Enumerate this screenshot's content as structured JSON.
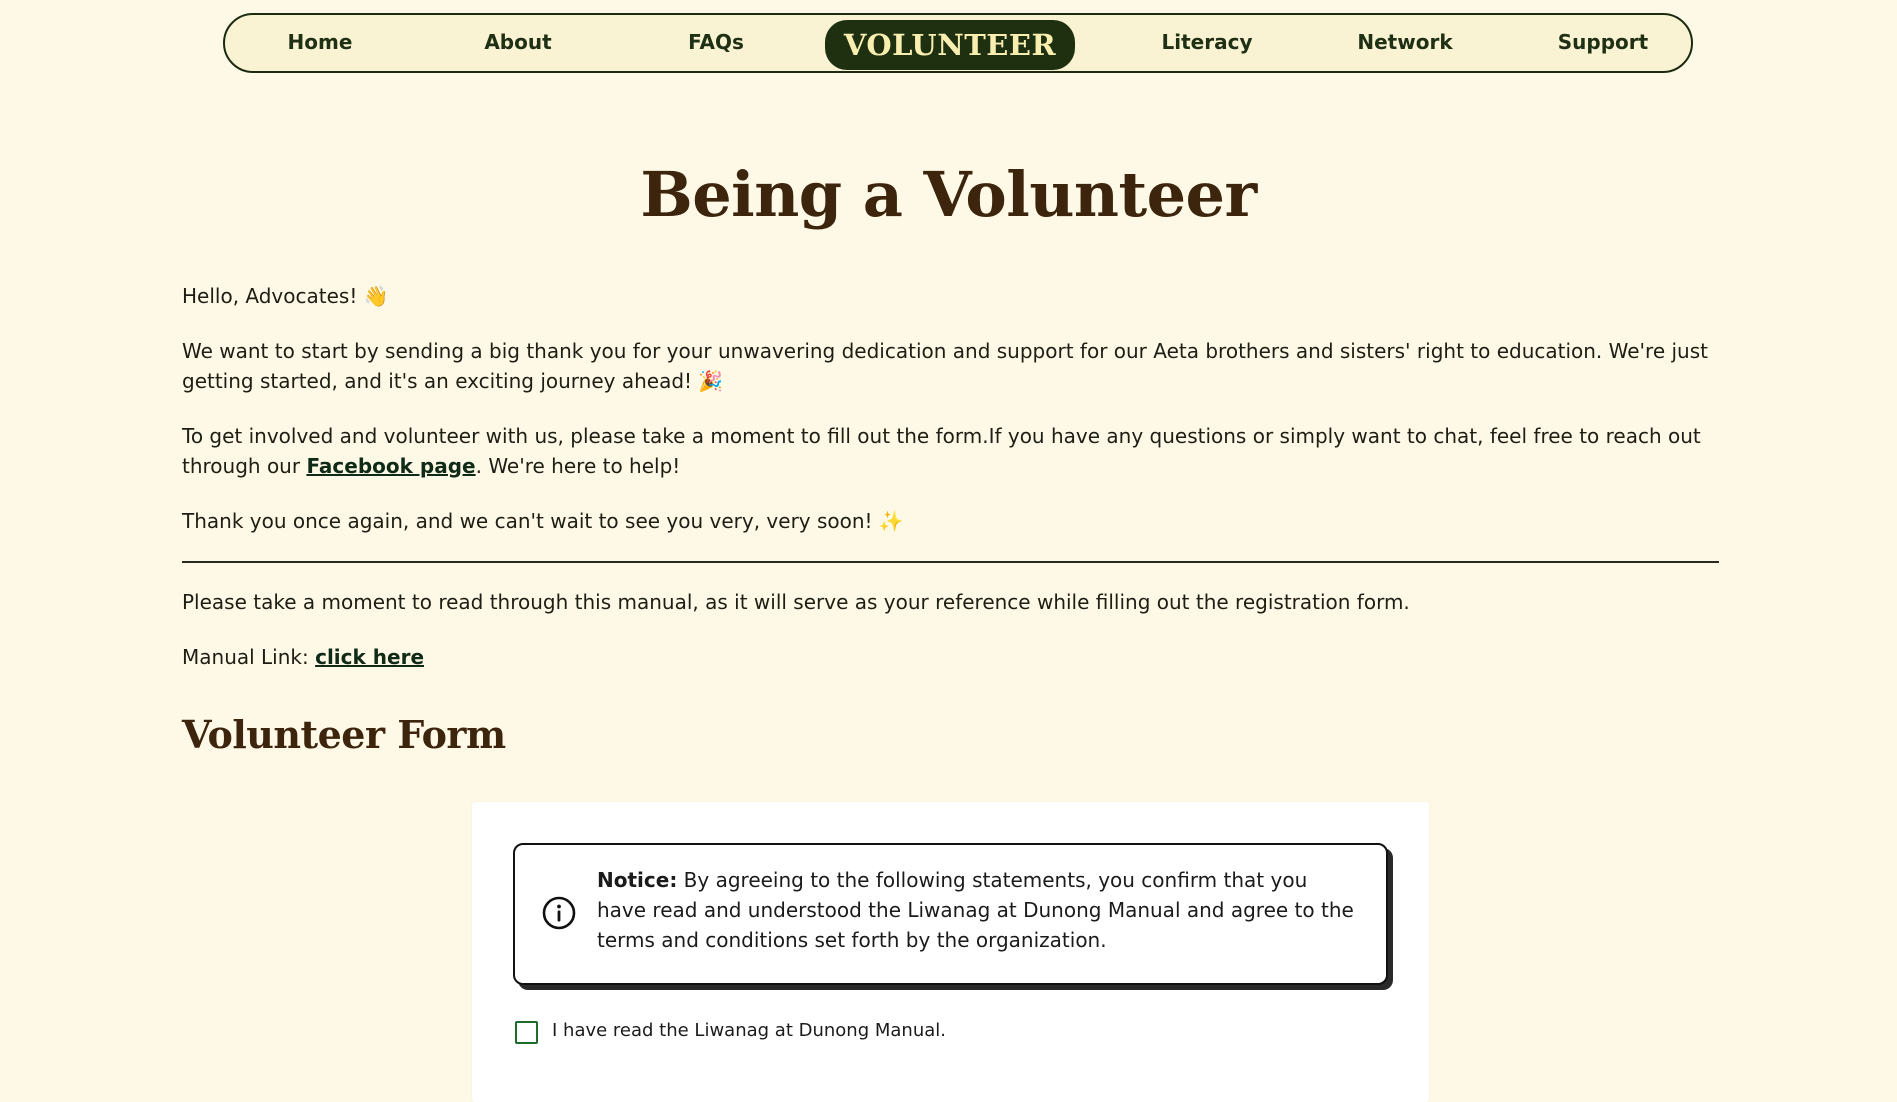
{
  "nav": {
    "items": [
      {
        "label": "Home"
      },
      {
        "label": "About"
      },
      {
        "label": "FAQs"
      },
      {
        "label": "VOLUNTEER",
        "active": true
      },
      {
        "label": "Literacy"
      },
      {
        "label": "Network"
      },
      {
        "label": "Support"
      }
    ]
  },
  "page": {
    "title": "Being a Volunteer",
    "greeting": "Hello, Advocates! 👋",
    "para1": "We want to start by sending a big thank you for your unwavering dedication and support for our Aeta brothers and sisters' right to education. We're just getting started, and it's an exciting journey ahead! 🎉",
    "para2_before": "To get involved and volunteer with us, please take a moment to fill out the form.If you have any questions or simply want to chat, feel free to reach out through our ",
    "para2_link": "Facebook page",
    "para2_after": ". We're here to help!",
    "para3": "Thank you once again, and we can't wait to see you very, very soon! ✨",
    "manual_note": "Please take a moment to read through this manual, as it will serve as your reference while filling out the registration form.",
    "manual_label": "Manual Link: ",
    "manual_link": "click here"
  },
  "form": {
    "heading": "Volunteer Form",
    "notice_label": "Notice:",
    "notice_text": " By agreeing to the following statements, you confirm that you have read and understood the Liwanag at Dunong Manual and agree to the terms and conditions set forth by the organization.",
    "checkbox1_label": "I have read the Liwanag at Dunong Manual."
  },
  "colors": {
    "background": "#fef9e6",
    "nav_active_bg": "#1f3010",
    "nav_active_text": "#f8eeb0",
    "heading": "#3d240c",
    "checkbox_border": "#1e6b2e"
  },
  "icons": {
    "notice": "info-circle-icon"
  }
}
